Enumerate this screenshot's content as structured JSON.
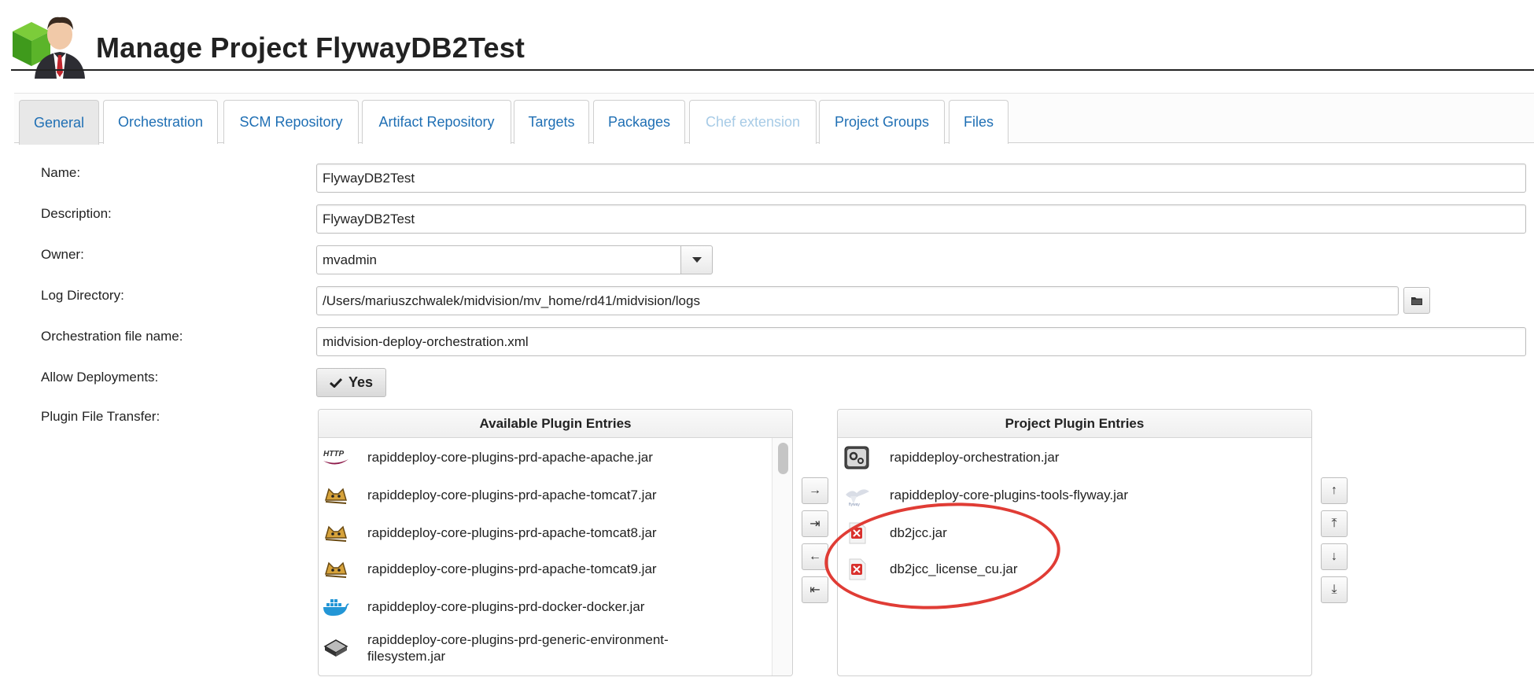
{
  "page": {
    "title": "Manage Project FlywayDB2Test"
  },
  "tabs": [
    {
      "label": "General",
      "state": "active"
    },
    {
      "label": "Orchestration",
      "state": "normal"
    },
    {
      "label": "SCM Repository",
      "state": "normal"
    },
    {
      "label": "Artifact Repository",
      "state": "normal"
    },
    {
      "label": "Targets",
      "state": "normal"
    },
    {
      "label": "Packages",
      "state": "normal"
    },
    {
      "label": "Chef extension",
      "state": "disabled"
    },
    {
      "label": "Project Groups",
      "state": "normal"
    },
    {
      "label": "Files",
      "state": "normal"
    }
  ],
  "form": {
    "name": {
      "label": "Name:",
      "value": "FlywayDB2Test"
    },
    "description": {
      "label": "Description:",
      "value": "FlywayDB2Test"
    },
    "owner": {
      "label": "Owner:",
      "value": "mvadmin"
    },
    "log_directory": {
      "label": "Log Directory:",
      "value": "/Users/mariuszchwalek/midvision/mv_home/rd41/midvision/logs"
    },
    "orchestration_file": {
      "label": "Orchestration file name:",
      "value": "midvision-deploy-orchestration.xml"
    },
    "allow_deployments": {
      "label": "Allow Deployments:",
      "value": "Yes"
    },
    "plugin_transfer": {
      "label": "Plugin File Transfer:"
    }
  },
  "available_plugins": {
    "header": "Available Plugin Entries",
    "items": [
      {
        "name": "rapiddeploy-core-plugins-prd-apache-apache.jar",
        "icon": "http-icon"
      },
      {
        "name": "rapiddeploy-core-plugins-prd-apache-tomcat7.jar",
        "icon": "tomcat-icon"
      },
      {
        "name": "rapiddeploy-core-plugins-prd-apache-tomcat8.jar",
        "icon": "tomcat-icon"
      },
      {
        "name": "rapiddeploy-core-plugins-prd-apache-tomcat9.jar",
        "icon": "tomcat-icon"
      },
      {
        "name": "rapiddeploy-core-plugins-prd-docker-docker.jar",
        "icon": "docker-icon"
      },
      {
        "name": "rapiddeploy-core-plugins-prd-generic-environment-",
        "name_line2": "filesystem.jar",
        "icon": "filesystem-icon"
      }
    ]
  },
  "transfer_buttons": [
    {
      "glyph": "→",
      "icon": "move-right-icon"
    },
    {
      "glyph": "⇥",
      "icon": "move-all-right-icon"
    },
    {
      "glyph": "←",
      "icon": "move-left-icon"
    },
    {
      "glyph": "⇤",
      "icon": "move-all-left-icon"
    }
  ],
  "project_plugins": {
    "header": "Project Plugin Entries",
    "items": [
      {
        "name": "rapiddeploy-orchestration.jar",
        "icon": "gear-box-icon"
      },
      {
        "name": "rapiddeploy-core-plugins-tools-flyway.jar",
        "icon": "flyway-icon"
      },
      {
        "name": "db2jcc.jar",
        "icon": "error-file-icon"
      },
      {
        "name": "db2jcc_license_cu.jar",
        "icon": "error-file-icon"
      }
    ]
  },
  "order_buttons": [
    {
      "glyph": "↑",
      "icon": "move-up-icon"
    },
    {
      "glyph": "⤒",
      "icon": "move-top-icon"
    },
    {
      "glyph": "↓",
      "icon": "move-down-icon"
    },
    {
      "glyph": "⤓",
      "icon": "move-bottom-icon"
    }
  ],
  "colors": {
    "link": "#1f6fb4",
    "disabled_tab": "#a7cbe6",
    "annotation": "#e03c35",
    "error_icon": "#d9302c"
  }
}
